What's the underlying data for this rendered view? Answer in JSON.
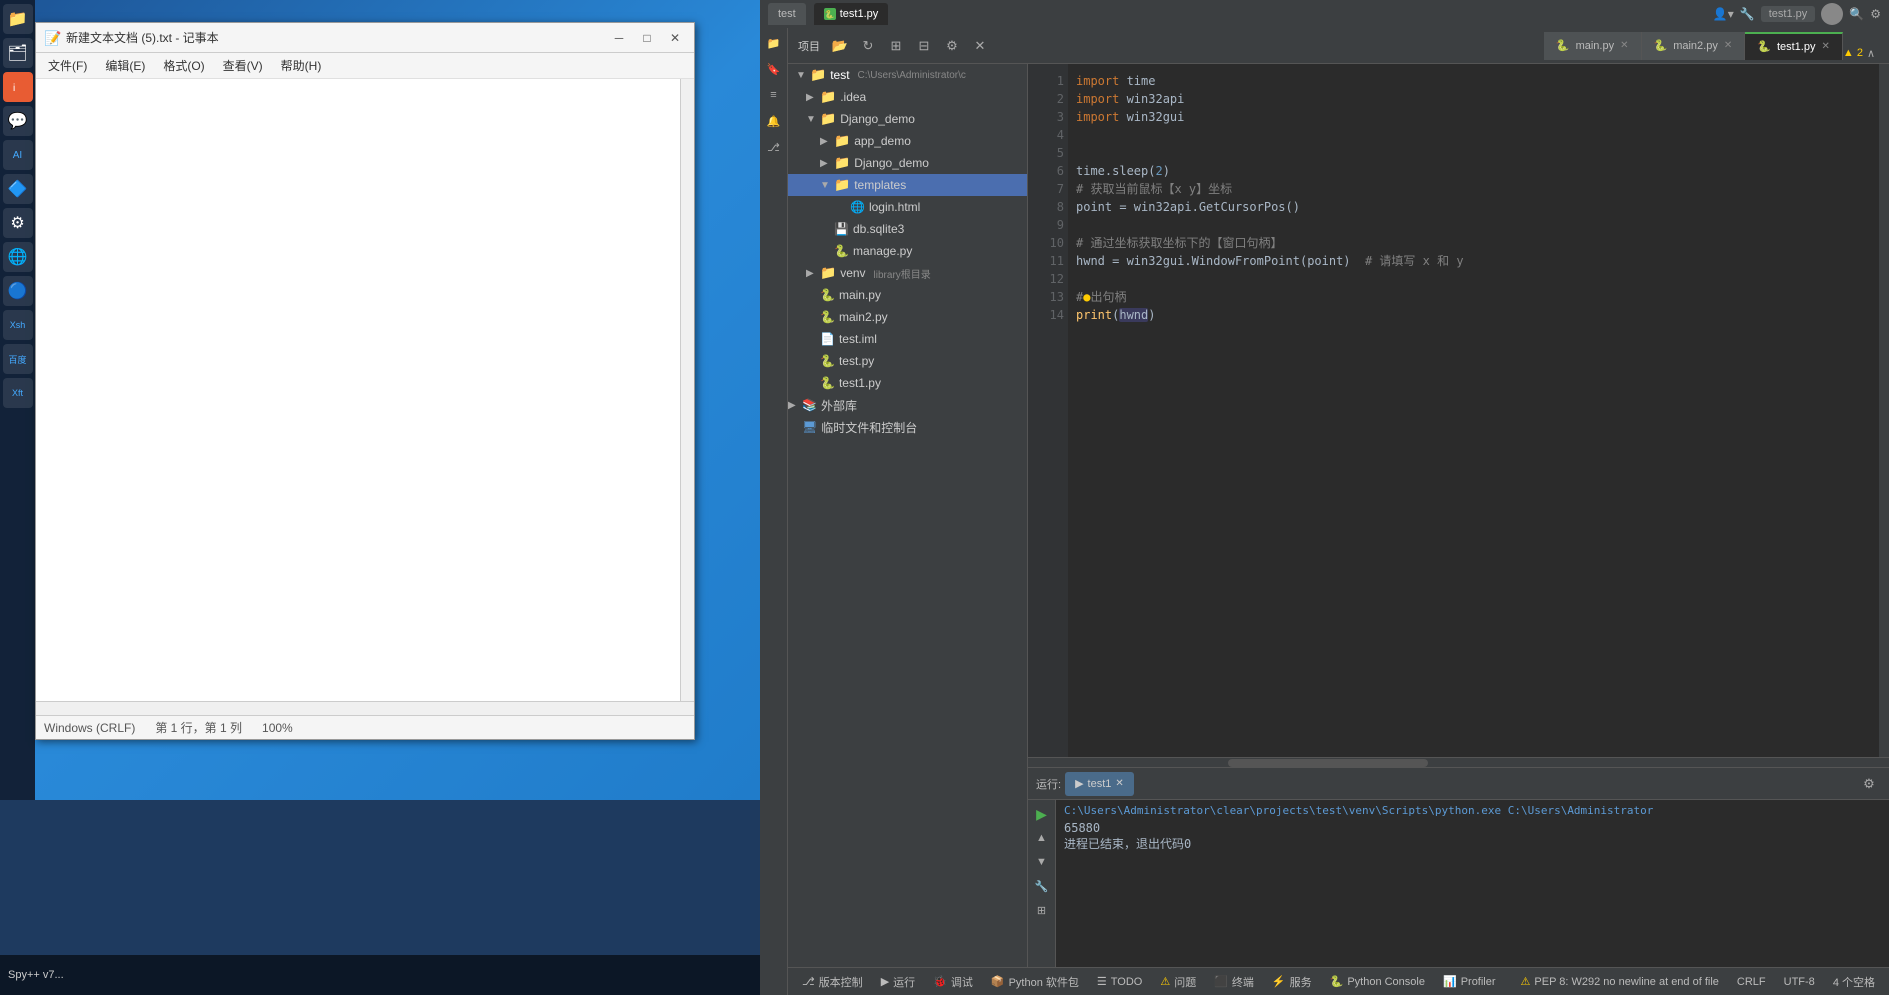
{
  "desktop": {
    "bg_color": "#1e3a5f"
  },
  "notepad": {
    "title": "新建文本文档 (5).txt - 记事本",
    "menu": {
      "file": "文件(F)",
      "edit": "编辑(E)",
      "format": "格式(O)",
      "view": "查看(V)",
      "help": "帮助(H)"
    },
    "statusbar": {
      "encoding": "Windows (CRLF)",
      "position": "第 1 行，第 1 列",
      "zoom": "100%"
    }
  },
  "pycharm": {
    "title_tab_test": "test",
    "title_tab_test1": "test1.py",
    "editor_tabs": [
      {
        "label": "main.py",
        "active": false,
        "icon": "py"
      },
      {
        "label": "main2.py",
        "active": false,
        "icon": "py"
      },
      {
        "label": "test1.py",
        "active": true,
        "icon": "py"
      }
    ],
    "toolbar": {
      "items": [
        "folder",
        "refresh",
        "expand",
        "collapse",
        "settings",
        "close"
      ]
    },
    "project_label": "项目",
    "file_tree": {
      "root": {
        "name": "test",
        "path": "C:\\Users\\Administrator\\c",
        "children": [
          {
            "name": ".idea",
            "type": "folder",
            "indent": 1,
            "expanded": false
          },
          {
            "name": "Django_demo",
            "type": "folder",
            "indent": 1,
            "expanded": false
          },
          {
            "name": "app_demo",
            "type": "folder",
            "indent": 2,
            "expanded": false
          },
          {
            "name": "Django_demo",
            "type": "folder",
            "indent": 2,
            "expanded": false
          },
          {
            "name": "templates",
            "type": "folder",
            "indent": 2,
            "expanded": true,
            "highlighted": true
          },
          {
            "name": "login.html",
            "type": "html",
            "indent": 3
          },
          {
            "name": "db.sqlite3",
            "type": "db",
            "indent": 2
          },
          {
            "name": "manage.py",
            "type": "py",
            "indent": 2
          },
          {
            "name": "venv",
            "type": "folder",
            "indent": 1,
            "label": "library根目录",
            "expanded": false
          },
          {
            "name": "main.py",
            "type": "py",
            "indent": 1
          },
          {
            "name": "main2.py",
            "type": "py",
            "indent": 1
          },
          {
            "name": "test.iml",
            "type": "iml",
            "indent": 1
          },
          {
            "name": "test.py",
            "type": "py",
            "indent": 1
          },
          {
            "name": "test1.py",
            "type": "py",
            "indent": 1
          },
          {
            "name": "外部库",
            "type": "folder-special",
            "indent": 0,
            "expanded": false
          },
          {
            "name": "临时文件和控制台",
            "type": "special",
            "indent": 0
          }
        ]
      }
    },
    "code": {
      "lines": [
        {
          "num": 1,
          "content": "import time"
        },
        {
          "num": 2,
          "content": "import win32api"
        },
        {
          "num": 3,
          "content": "import win32gui"
        },
        {
          "num": 4,
          "content": ""
        },
        {
          "num": 5,
          "content": ""
        },
        {
          "num": 6,
          "content": "time.sleep(2)"
        },
        {
          "num": 7,
          "content": "# 获取当前鼠标【x y】坐标"
        },
        {
          "num": 8,
          "content": "point = win32api.GetCursorPos()"
        },
        {
          "num": 9,
          "content": ""
        },
        {
          "num": 10,
          "content": "# 通过坐标获取坐标下的【窗口句柄】"
        },
        {
          "num": 11,
          "content": "hwnd = win32gui.WindowFromPoint(point)  # 请填写 x 和 y"
        },
        {
          "num": 12,
          "content": ""
        },
        {
          "num": 13,
          "content": "#●出句柄"
        },
        {
          "num": 14,
          "content": "print(hwnd)"
        }
      ],
      "warning_count": "2"
    },
    "run_panel": {
      "tab_label": "运行:",
      "run_name": "test1",
      "path": "C:\\Users\\Administrator\\clear\\projects\\test\\venv\\Scripts\\python.exe  C:\\Users\\Administrator",
      "output_number": "65880",
      "exit_msg": "进程已结束，退出代码0"
    },
    "status_bar": {
      "version_control": "版本控制",
      "run": "▶ 运行",
      "debug": "调试",
      "python_packages": "Python 软件包",
      "todo": "TODO",
      "problems": "问题",
      "terminal": "终端",
      "services": "服务",
      "python_console": "Python Console",
      "profiler": "Profiler",
      "right": {
        "warning": "PEP 8: W292 no newline at end of file",
        "line_ending": "CRLF",
        "encoding": "UTF-8",
        "indent": "4 个空格"
      }
    }
  },
  "spy_taskbar": {
    "label": "Spy++ v7..."
  },
  "icons": {
    "folder": "📁",
    "file": "📄",
    "py_file": "🐍",
    "html_file": "🌐",
    "run": "▶",
    "up": "▲",
    "down": "▼",
    "settings": "⚙",
    "close_tab": "✕",
    "warning": "⚠",
    "tree_arrow_right": "▶",
    "tree_arrow_down": "▼"
  }
}
